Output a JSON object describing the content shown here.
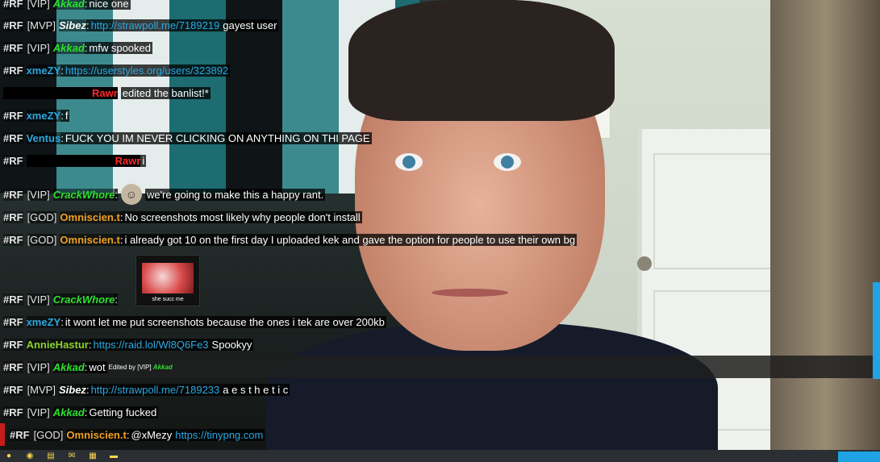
{
  "chat": {
    "rows": [
      {
        "tag": "#RF",
        "rank": "[VIP]",
        "name": "Akkad",
        "msg": "nice one"
      },
      {
        "tag": "#RF",
        "rank": "[MVP]",
        "name": "Sibez",
        "link": "http://strawpoll.me/7189219",
        "msg": "gayest user"
      },
      {
        "tag": "#RF",
        "rank": "[VIP]",
        "name": "Akkad",
        "msg": "mfw spooked"
      },
      {
        "tag": "#RF",
        "name": "xmeZY",
        "link": "https://userstyles.org/users/323892"
      },
      {
        "name": "Rawr",
        "msg": "edited the banlist!*"
      },
      {
        "tag": "#RF",
        "name": "xmeZY",
        "msg": "f"
      },
      {
        "tag": "#RF",
        "name": "Ventus",
        "msg": "FUCK YOU IM NEVER CLICKING ON ANYTHING ON THI PAGE"
      },
      {
        "tag": "#RF",
        "name": "Rawr",
        "msg": "i"
      },
      {
        "tag": "#RF",
        "rank": "[VIP]",
        "name": "CrackWhore",
        "msg": "we're going to make this a happy rant."
      },
      {
        "tag": "#RF",
        "rank": "[GOD]",
        "name": "Omniscien.t",
        "msg": "No screenshots most likely why people don't install"
      },
      {
        "tag": "#RF",
        "rank": "[GOD]",
        "name": "Omniscien.t",
        "msg": "i already got 10 on the first day I uploaded kek and gave the option for people to use their own bg"
      },
      {
        "tag": "#RF",
        "rank": "[VIP]",
        "name": "CrackWhore",
        "emote_caption": "she succ me"
      },
      {
        "tag": "#RF",
        "name": "xmeZY",
        "msg": "it wont let me put screenshots because the ones i tek are over 200kb"
      },
      {
        "tag": "#RF",
        "name": "AnnieHastur",
        "link": "https://raid.lol/Wl8Q6Fe3",
        "msg": "Spookyy"
      },
      {
        "tag": "#RF",
        "rank": "[VIP]",
        "name": "Akkad",
        "msg": "wot",
        "edited": "Edited by [VIP]",
        "edited_name": "Akkad"
      },
      {
        "tag": "#RF",
        "rank": "[MVP]",
        "name": "Sibez",
        "link": "http://strawpoll.me/7189233",
        "msg": "a e s t h e t i c"
      },
      {
        "tag": "#RF",
        "rank": "[VIP]",
        "name": "Akkad",
        "msg": "Getting fucked"
      },
      {
        "tag": "#RF",
        "rank": "[GOD]",
        "name": "Omniscien.t",
        "msg": "@xMezy",
        "link": "https://tinypng.com"
      }
    ]
  },
  "colors": {
    "vip": "#2ee02e",
    "god": "#f0a020",
    "link": "#2ba8e2",
    "accent": "#1fa3e4",
    "mine": "#c81c1c"
  },
  "taskbar": {
    "icons": [
      "start-icon",
      "chrome-icon",
      "files-icon",
      "mail-icon",
      "doc-icon",
      "folder-icon"
    ]
  }
}
